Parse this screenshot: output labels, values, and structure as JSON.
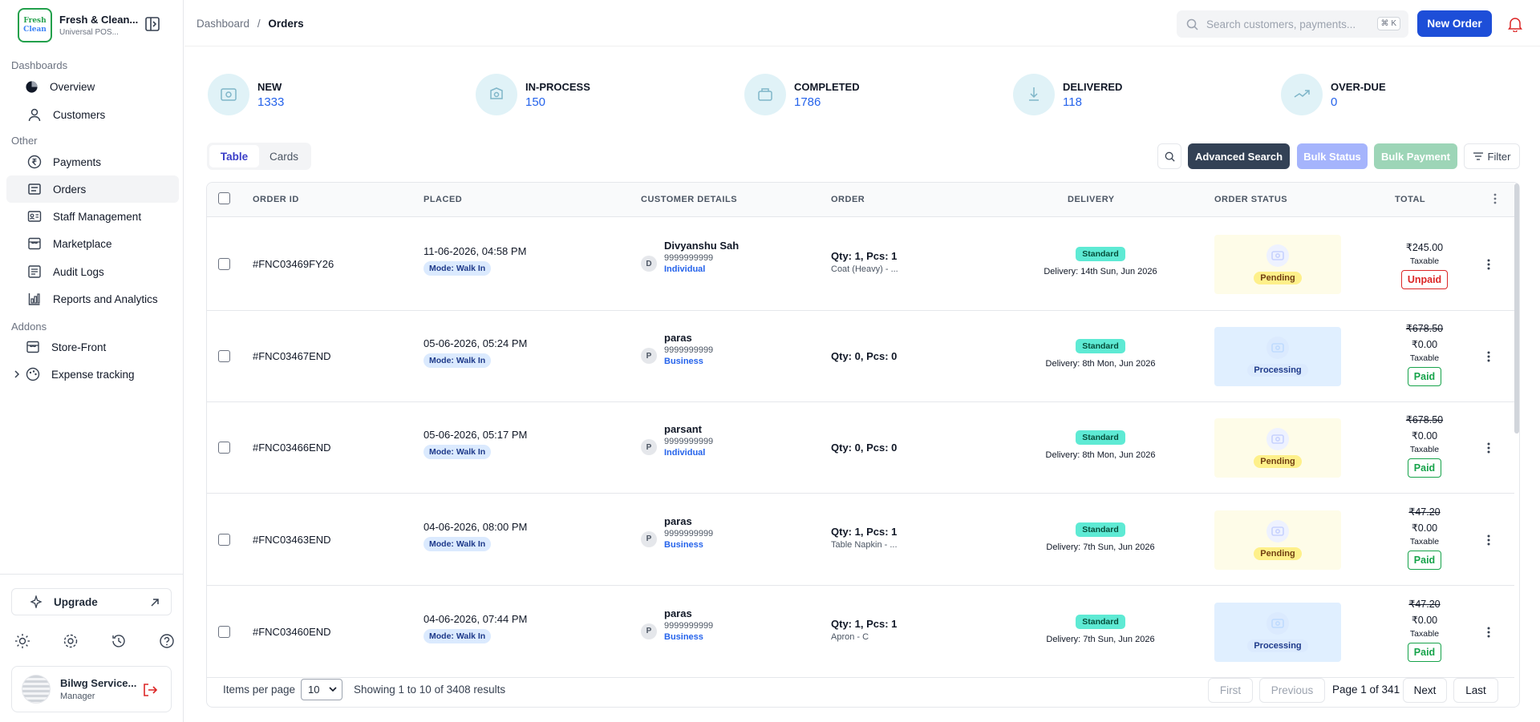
{
  "brand": {
    "name": "Fresh & Clean...",
    "sub": "Universal POS...",
    "logo_line1": "Fresh",
    "logo_line2": "Clean"
  },
  "sidebar": {
    "sections": {
      "dashboards": "Dashboards",
      "other": "Other",
      "addons": "Addons"
    },
    "items": [
      {
        "label": "Overview",
        "icon": "pie-chart-icon"
      },
      {
        "label": "Customers",
        "icon": "user-icon"
      },
      {
        "label": "Payments",
        "icon": "rupee-icon"
      },
      {
        "label": "Orders",
        "icon": "orders-icon"
      },
      {
        "label": "Staff Management",
        "icon": "id-card-icon"
      },
      {
        "label": "Marketplace",
        "icon": "store-icon"
      },
      {
        "label": "Audit Logs",
        "icon": "document-icon"
      },
      {
        "label": "Reports and Analytics",
        "icon": "report-icon"
      },
      {
        "label": "Store-Front",
        "icon": "storefront-icon"
      },
      {
        "label": "Expense tracking",
        "icon": "palette-icon"
      }
    ],
    "upgrade": "Upgrade",
    "user": {
      "name": "Bilwg Service...",
      "role": "Manager"
    }
  },
  "header": {
    "breadcrumb_root": "Dashboard",
    "breadcrumb_sep": "/",
    "breadcrumb_current": "Orders",
    "search_placeholder": "Search customers, payments...",
    "search_kbd": "⌘ K",
    "new_order": "New Order"
  },
  "stats": [
    {
      "label": "NEW",
      "value": "1333"
    },
    {
      "label": "IN-PROCESS",
      "value": "150"
    },
    {
      "label": "COMPLETED",
      "value": "1786"
    },
    {
      "label": "DELIVERED",
      "value": "118"
    },
    {
      "label": "OVER-DUE",
      "value": "0"
    }
  ],
  "view_toggle": {
    "table": "Table",
    "cards": "Cards"
  },
  "toolbar": {
    "advanced_search": "Advanced Search",
    "bulk_status": "Bulk Status",
    "bulk_payment": "Bulk Payment",
    "filter": "Filter"
  },
  "table": {
    "columns": [
      "ORDER ID",
      "PLACED",
      "CUSTOMER DETAILS",
      "ORDER",
      "DELIVERY",
      "ORDER STATUS",
      "TOTAL"
    ],
    "rows": [
      {
        "id": "#FNC03469FY26",
        "placed": "11-06-2026, 04:58 PM",
        "mode": "Mode: Walk In",
        "initial": "D",
        "customer": "Divyanshu Sah",
        "phone": "9999999999",
        "ctype": "Individual",
        "qty": "Qty: 1, Pcs: 1",
        "item": "Coat (Heavy) - ...",
        "delivery_type": "Standard",
        "delivery": "Delivery: 14th Sun, Jun 2026",
        "status": "Pending",
        "original": "",
        "total": "₹245.00",
        "tax": "Taxable",
        "payment": "Unpaid"
      },
      {
        "id": "#FNC03467END",
        "placed": "05-06-2026, 05:24 PM",
        "mode": "Mode: Walk In",
        "initial": "P",
        "customer": "paras",
        "phone": "9999999999",
        "ctype": "Business",
        "qty": "Qty: 0, Pcs: 0",
        "item": "",
        "delivery_type": "Standard",
        "delivery": "Delivery: 8th Mon, Jun 2026",
        "status": "Processing",
        "original": "₹678.50",
        "total": "₹0.00",
        "tax": "Taxable",
        "payment": "Paid"
      },
      {
        "id": "#FNC03466END",
        "placed": "05-06-2026, 05:17 PM",
        "mode": "Mode: Walk In",
        "initial": "P",
        "customer": "parsant",
        "phone": "9999999999",
        "ctype": "Individual",
        "qty": "Qty: 0, Pcs: 0",
        "item": "",
        "delivery_type": "Standard",
        "delivery": "Delivery: 8th Mon, Jun 2026",
        "status": "Pending",
        "original": "₹678.50",
        "total": "₹0.00",
        "tax": "Taxable",
        "payment": "Paid"
      },
      {
        "id": "#FNC03463END",
        "placed": "04-06-2026, 08:00 PM",
        "mode": "Mode: Walk In",
        "initial": "P",
        "customer": "paras",
        "phone": "9999999999",
        "ctype": "Business",
        "qty": "Qty: 1, Pcs: 1",
        "item": "Table Napkin - ...",
        "delivery_type": "Standard",
        "delivery": "Delivery: 7th Sun, Jun 2026",
        "status": "Pending",
        "original": "₹47.20",
        "total": "₹0.00",
        "tax": "Taxable",
        "payment": "Paid"
      },
      {
        "id": "#FNC03460END",
        "placed": "04-06-2026, 07:44 PM",
        "mode": "Mode: Walk In",
        "initial": "P",
        "customer": "paras",
        "phone": "9999999999",
        "ctype": "Business",
        "qty": "Qty: 1, Pcs: 1",
        "item": "Apron - C",
        "delivery_type": "Standard",
        "delivery": "Delivery: 7th Sun, Jun 2026",
        "status": "Processing",
        "original": "₹47.20",
        "total": "₹0.00",
        "tax": "Taxable",
        "payment": "Paid"
      }
    ]
  },
  "footer": {
    "items_per_page_label": "Items per page",
    "items_per_page": "10",
    "showing": "Showing 1 to 10 of 3408 results",
    "first": "First",
    "previous": "Previous",
    "page": "Page 1 of 341",
    "next": "Next",
    "last": "Last"
  },
  "colors": {
    "accent": "#1d4ed8",
    "pending_bg": "#fefce8",
    "processing_bg": "#e0efff",
    "standard": "#5eead4"
  }
}
